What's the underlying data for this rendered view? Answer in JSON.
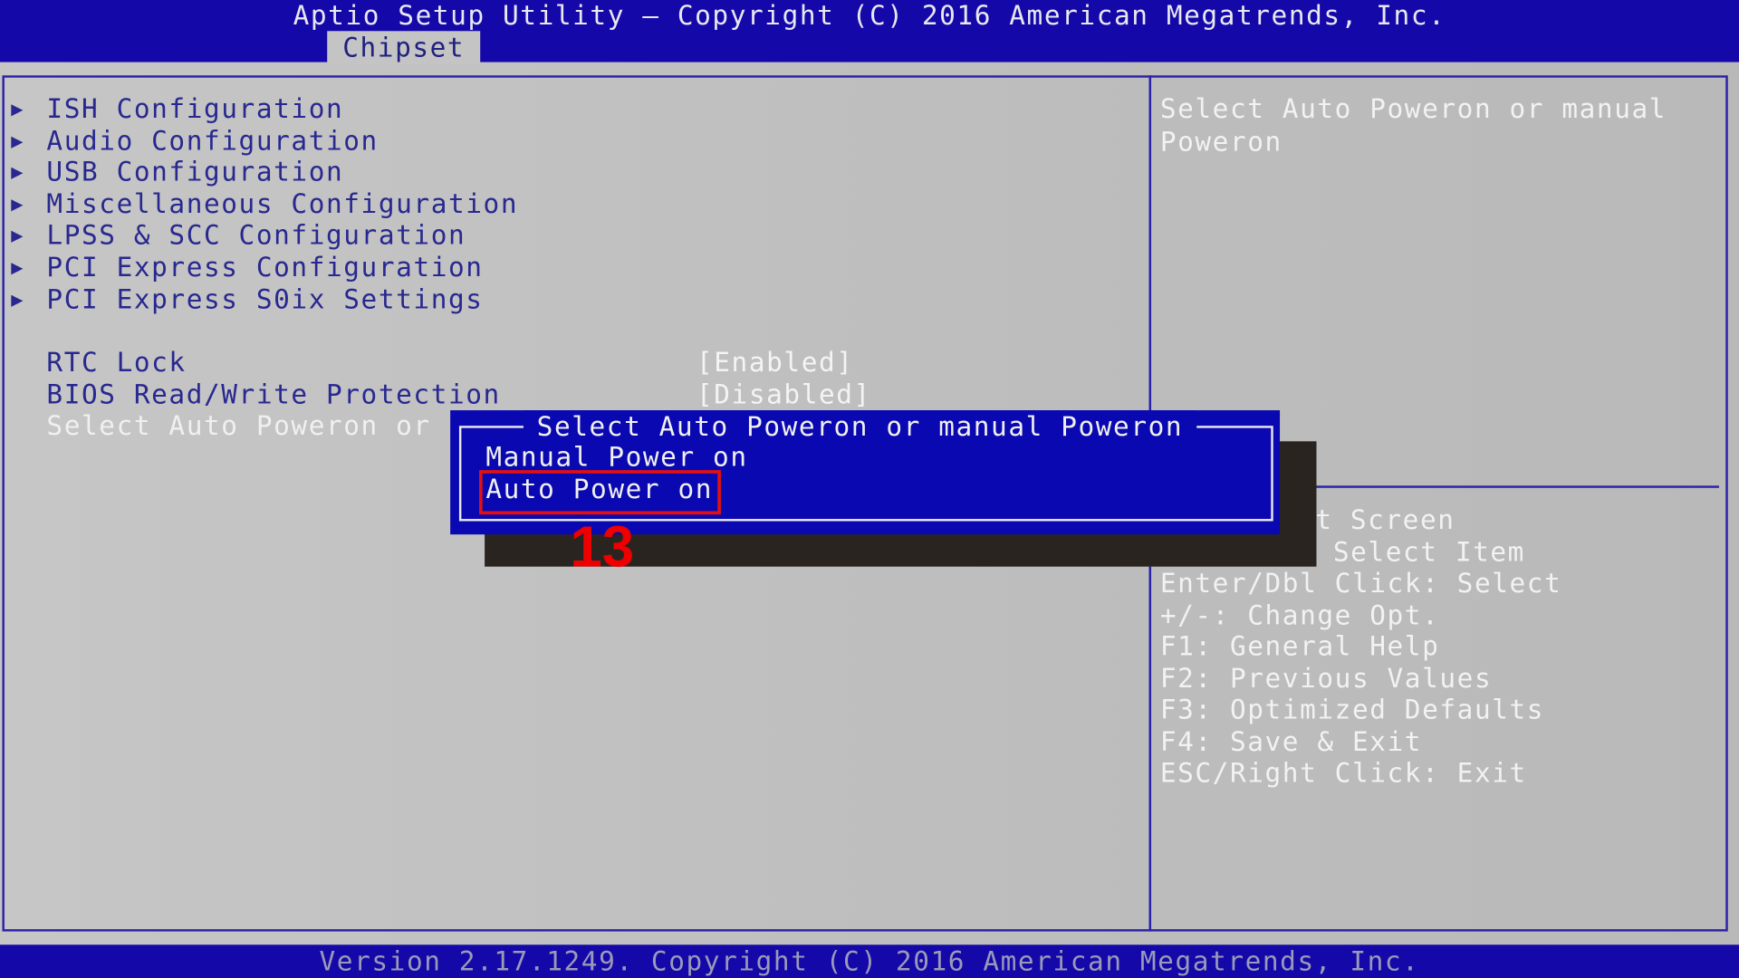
{
  "header": {
    "title": "Aptio Setup Utility – Copyright (C) 2016 American Megatrends, Inc.",
    "active_tab": "Chipset"
  },
  "menu": {
    "submenus": [
      "ISH Configuration",
      "Audio Configuration",
      "USB Configuration",
      "Miscellaneous Configuration",
      "LPSS & SCC Configuration",
      "PCI Express Configuration",
      "PCI Express S0ix Settings"
    ],
    "settings": [
      {
        "label": "RTC Lock",
        "value": "[Enabled]"
      },
      {
        "label": "BIOS Read/Write Protection",
        "value": "[Disabled]"
      },
      {
        "label": "Select Auto Poweron or",
        "value": ""
      }
    ]
  },
  "help": {
    "description": [
      "Select Auto Poweron or manual",
      "Poweron"
    ],
    "keys": [
      "t Screen",
      "Select Item",
      "Enter/Dbl Click: Select",
      "+/-: Change Opt.",
      "F1: General Help",
      "F2: Previous Values",
      "F3: Optimized Defaults",
      "F4: Save & Exit",
      "ESC/Right Click: Exit"
    ]
  },
  "popup": {
    "title": "Select Auto Poweron or manual Poweron",
    "options": [
      "Manual Power on",
      "Auto Power on"
    ],
    "selected": "Auto Power on"
  },
  "annotation": "13",
  "footer": "Version 2.17.1249. Copyright (C) 2016 American Megatrends, Inc.",
  "colors": {
    "header_bg": "#1508a8",
    "popup_bg": "#0a08b0",
    "highlight_border": "#e41010"
  }
}
